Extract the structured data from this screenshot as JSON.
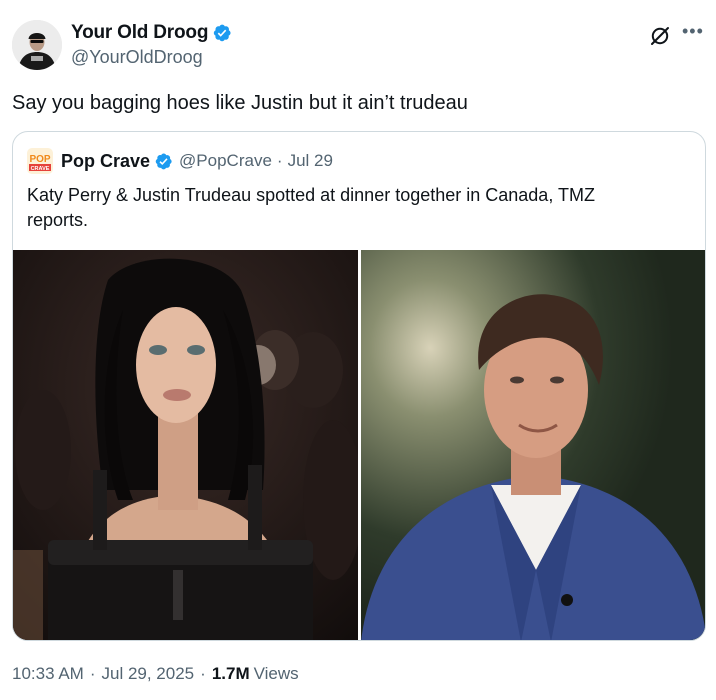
{
  "author": {
    "name": "Your Old Droog",
    "handle": "@YourOldDroog",
    "verified": true,
    "avatar_icon": "user-avatar"
  },
  "tweet": {
    "text": "Say you bagging hoes like Justin but it ain’t trudeau"
  },
  "header_icons": [
    "grok-icon",
    "more-icon"
  ],
  "quote": {
    "name": "Pop Crave",
    "handle": "@PopCrave",
    "separator": "·",
    "date": "Jul 29",
    "verified": true,
    "avatar_logo_text": "POP CRAVE",
    "text": "Katy Perry & Justin Trudeau spotted at dinner together in Canada, TMZ reports.",
    "images": [
      {
        "name": "photo-katy-perry"
      },
      {
        "name": "photo-justin-trudeau"
      }
    ]
  },
  "meta": {
    "time": "10:33 AM",
    "separator": "·",
    "date": "Jul 29, 2025",
    "views_count": "1.7M",
    "views_label": "Views"
  },
  "colors": {
    "text": "#0f1419",
    "secondary": "#536471",
    "border": "#cfd9de",
    "verified_blue": "#1d9bf0",
    "pop_crave_orange": "#f5a623"
  }
}
